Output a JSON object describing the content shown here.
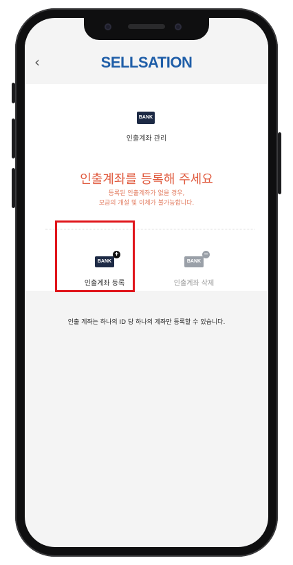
{
  "header": {
    "back_icon": "chevron-left",
    "logo_text": "SELLSATION"
  },
  "section": {
    "icon_text": "BANK",
    "title": "인출계좌 관리"
  },
  "main": {
    "heading": "인출계좌를 등록해 주세요",
    "sub_line1": "등록된 인출계좌가 없을 경우,",
    "sub_line2": "모금의 개설 및 이체가 불가능합니다."
  },
  "options": {
    "register": {
      "icon_text": "BANK",
      "badge": "+",
      "label": "인출계좌 등록",
      "highlighted": true
    },
    "delete": {
      "icon_text": "BANK",
      "badge": "−",
      "label": "인출계좌 삭제",
      "enabled": false
    }
  },
  "note": "인출 계좌는 하나의 ID 당 하나의 계좌만 등록할 수 있습니다.",
  "colors": {
    "accent": "#e05a3e",
    "logo": "#1f5ea8",
    "highlight_box": "#e0151b",
    "bank_icon": "#1d2a45"
  }
}
